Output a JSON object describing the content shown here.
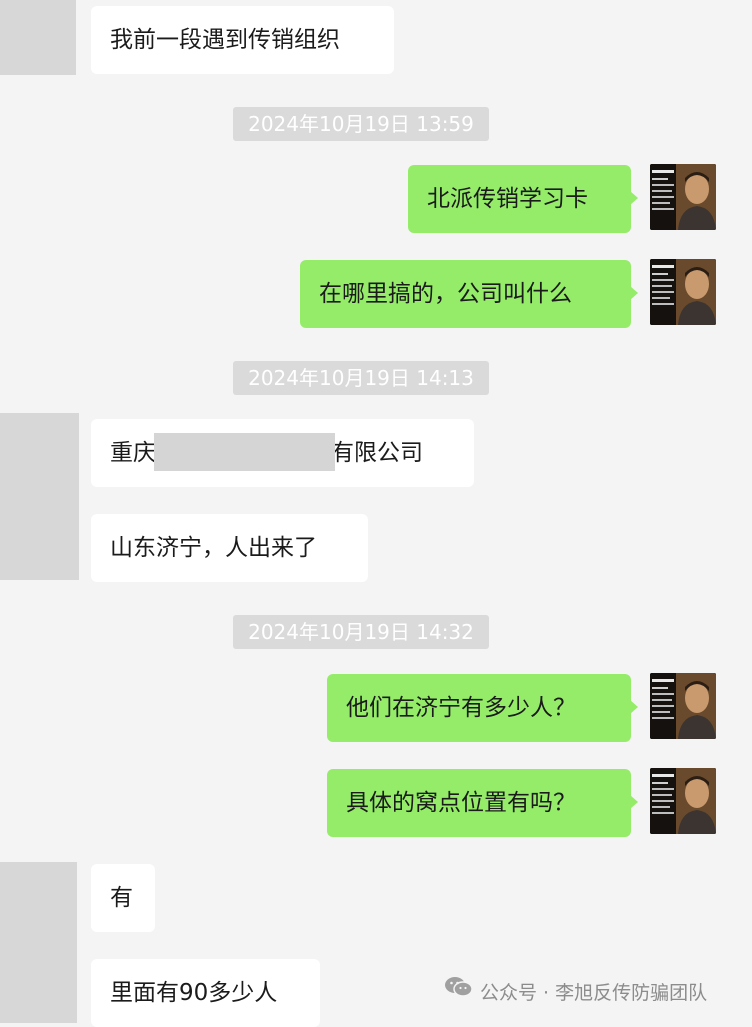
{
  "messages": {
    "m1": "我前一段遇到传销组织",
    "m2": "北派传销学习卡",
    "m3": "在哪里搞的，公司叫什么",
    "m4_prefix": "重庆",
    "m4_suffix": "有限公司",
    "m5": "山东济宁，人出来了",
    "m6": "他们在济宁有多少人？",
    "m7": "具体的窝点位置有吗？",
    "m8": "有",
    "m9": "里面有90多少人"
  },
  "timestamps": {
    "t1": "2024年10月19日 13:59",
    "t2": "2024年10月19日 14:13",
    "t3": "2024年10月19日 14:32"
  },
  "watermark": {
    "text": "公众号 · 李旭反传防骗团队"
  },
  "colors": {
    "background": "#f4f4f4",
    "incoming_bubble": "#ffffff",
    "outgoing_bubble": "#95ec69",
    "timestamp_pill": "#dadada",
    "redaction": "#d5d5d5"
  },
  "icons": {
    "watermark_icon": "wechat-icon"
  }
}
